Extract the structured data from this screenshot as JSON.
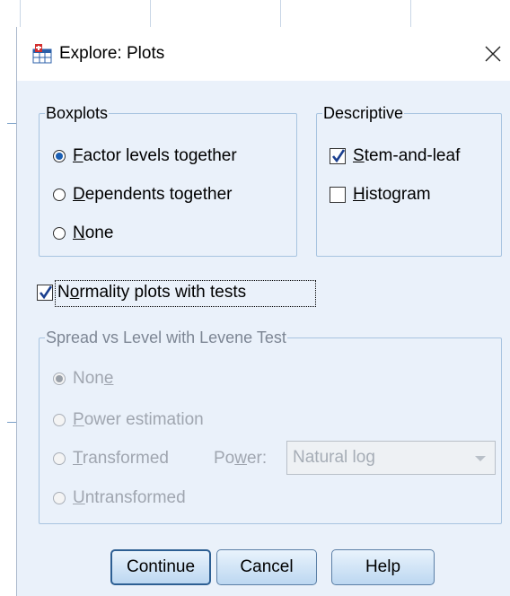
{
  "dialog": {
    "title": "Explore: Plots",
    "close_glyph": "✕"
  },
  "icons": {
    "app": "spss-chart-icon",
    "close": "close-icon"
  },
  "boxplots": {
    "label": "Boxplots",
    "options": [
      {
        "label": "Factor levels together",
        "mnemonic": "F",
        "rest": "actor levels together",
        "checked": true
      },
      {
        "label": "Dependents together",
        "mnemonic": "D",
        "rest": "ependents together",
        "checked": false
      },
      {
        "label": "None",
        "mnemonic": "N",
        "rest": "one",
        "checked": false
      }
    ]
  },
  "descriptive": {
    "label": "Descriptive",
    "options": [
      {
        "label": "Stem-and-leaf",
        "mnemonic": "S",
        "rest": "tem-and-leaf",
        "checked": true
      },
      {
        "label": "Histogram",
        "mnemonic": "H",
        "rest": "istogram",
        "checked": false
      }
    ]
  },
  "normality": {
    "label": "Normality plots with tests",
    "pre": "N",
    "mnemonic": "o",
    "rest": "rmality plots with tests",
    "checked": true
  },
  "spread": {
    "label": "Spread vs Level with Levene Test",
    "options": [
      {
        "label": "None",
        "pre": "Non",
        "mnemonic": "e",
        "rest": "",
        "checked": true,
        "enabled": false
      },
      {
        "label": "Power estimation",
        "pre": "",
        "mnemonic": "P",
        "rest": "ower estimation",
        "checked": false,
        "enabled": false
      },
      {
        "label": "Transformed",
        "pre": "",
        "mnemonic": "T",
        "rest": "ransformed",
        "checked": false,
        "enabled": false
      },
      {
        "label": "Untransformed",
        "pre": "",
        "mnemonic": "U",
        "rest": "ntransformed",
        "checked": false,
        "enabled": false
      }
    ],
    "power_label_pre": "Po",
    "power_label_mnemonic": "w",
    "power_label_rest": "er:",
    "power_value": "Natural log"
  },
  "buttons": {
    "continue": "Continue",
    "cancel": "Cancel",
    "help": "Help"
  },
  "colors": {
    "dialog_bg": "#eaf1fa",
    "group_border": "#a8c4e0",
    "accent": "#1a5fb4"
  }
}
